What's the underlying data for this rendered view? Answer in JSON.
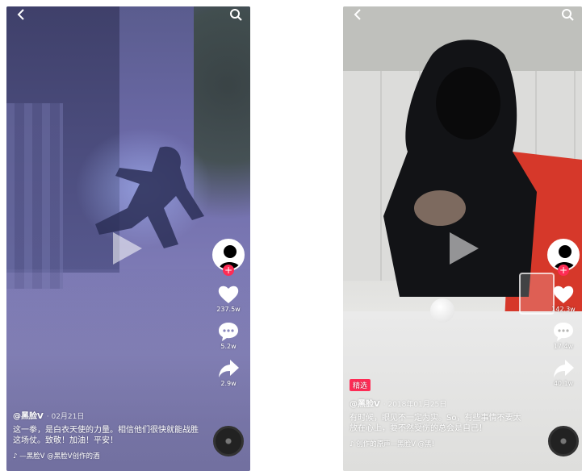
{
  "left": {
    "username": "@黑脸V",
    "date": "· 02月21日",
    "description": "这一拳，是白衣天使的力量。相信他们很快就能战胜这场仗。致敬！加油！平安！",
    "likes": "237.5w",
    "comments": "5.2w",
    "shares": "2.9w",
    "music": "♪ —黑脸V  @黑脸V创作的酒"
  },
  "right": {
    "tag": "精选",
    "username": "@黑脸V",
    "date": "· 2018年01月25日",
    "description": "有时候，眼见不一定为实。So，有些事情不要太放在心上，要不然受伤的总会是自己！",
    "likes": "142.3w",
    "comments": "17.4w",
    "shares": "40.1w",
    "music": "♪ 创作的原声—黑脸V  @黑!"
  },
  "colors": {
    "accent": "#fe2c55",
    "white": "#ffffff"
  },
  "icons": [
    "back-icon",
    "search-icon",
    "play-icon",
    "heart-icon",
    "comment-icon",
    "share-icon",
    "music-icon",
    "music-disc-icon"
  ]
}
